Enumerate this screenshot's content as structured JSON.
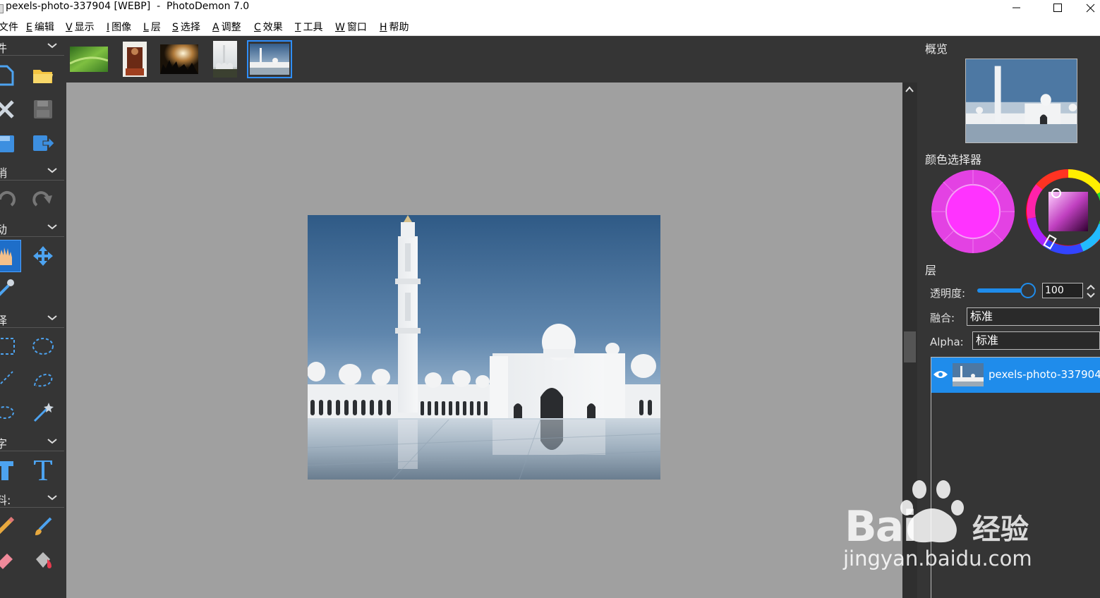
{
  "window": {
    "title": "pexels-photo-337904 [WEBP]  -  PhotoDemon 7.0"
  },
  "menu": {
    "items": [
      {
        "accel": "",
        "label": "文件"
      },
      {
        "accel": "E",
        "label": "编辑"
      },
      {
        "accel": "V",
        "label": "显示"
      },
      {
        "accel": "I",
        "label": "图像"
      },
      {
        "accel": "L",
        "label": "层"
      },
      {
        "accel": "S",
        "label": "选择"
      },
      {
        "accel": "A",
        "label": "调整"
      },
      {
        "accel": "C",
        "label": "效果"
      },
      {
        "accel": "T",
        "label": "工具"
      },
      {
        "accel": "W",
        "label": "窗口"
      },
      {
        "accel": "H",
        "label": "帮助"
      }
    ]
  },
  "toolbox": {
    "sections": [
      {
        "label": "件"
      },
      {
        "label": "销"
      },
      {
        "label": "动"
      },
      {
        "label": "择"
      },
      {
        "label": "字"
      },
      {
        "label": "料:"
      }
    ]
  },
  "thumbnails": {
    "selected_index": 4,
    "count": 5
  },
  "right_panel": {
    "overview_title": "概览",
    "color_title": "颜色选择器",
    "primary_color": "#ff33ff",
    "layers_title": "层",
    "opacity_label": "透明度:",
    "opacity_value": "100",
    "opacity_fraction": 1.0,
    "blend_label": "融合:",
    "blend_value": "标准",
    "alpha_label": "Alpha:",
    "alpha_value": "标准",
    "layer_name": "pexels-photo-337904"
  },
  "watermark": {
    "brand": "Bai",
    "brand_suffix": "经验",
    "url": "jingyan.baidu.com"
  },
  "colors": {
    "accent": "#1f8ceb",
    "canvas_bg": "#a0a0a0",
    "panel_bg": "#353535"
  }
}
